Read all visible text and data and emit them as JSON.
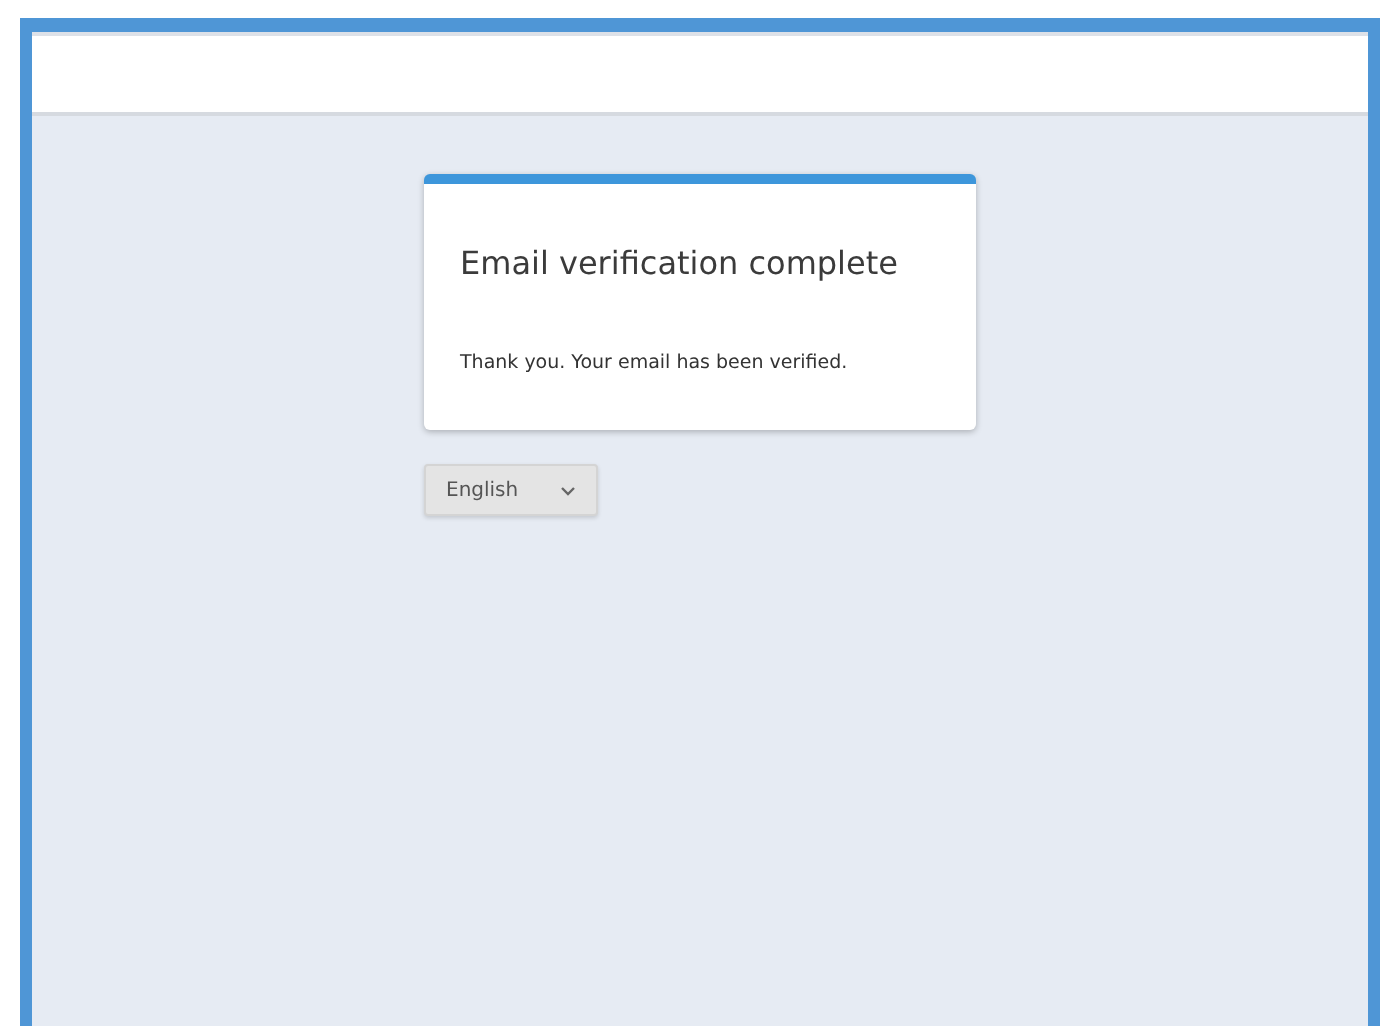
{
  "card": {
    "title": "Email verification complete",
    "message": "Thank you. Your email has been verified."
  },
  "language_select": {
    "value": "English"
  }
}
